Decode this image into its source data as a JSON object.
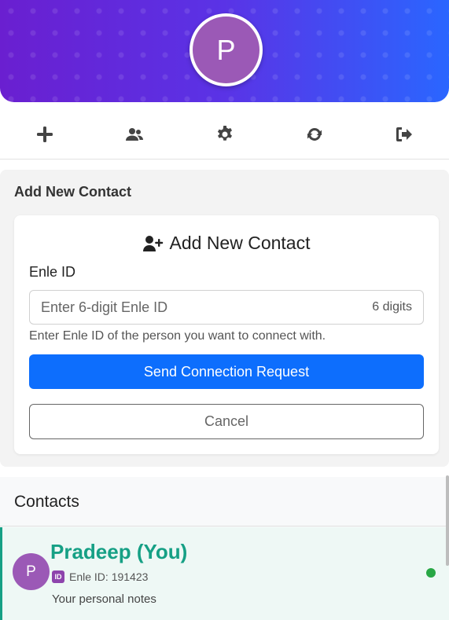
{
  "header": {
    "avatar_initial": "P"
  },
  "toolbar": {
    "items": [
      {
        "icon": "plus-icon"
      },
      {
        "icon": "users-icon"
      },
      {
        "icon": "gear-icon"
      },
      {
        "icon": "refresh-icon"
      },
      {
        "icon": "logout-icon"
      }
    ]
  },
  "add_contact": {
    "panel_title": "Add New Contact",
    "card_title": "Add New Contact",
    "field_label": "Enle ID",
    "input_placeholder": "Enter 6-digit Enle ID",
    "input_value": "",
    "input_hint": "6 digits",
    "help_text": "Enter Enle ID of the person you want to connect with.",
    "send_label": "Send Connection Request",
    "cancel_label": "Cancel"
  },
  "contacts": {
    "title": "Contacts",
    "items": [
      {
        "initial": "P",
        "name": "Pradeep (You)",
        "id_badge": "ID",
        "id_text": "Enle ID: 191423",
        "note": "Your personal notes",
        "status": "online"
      }
    ]
  },
  "colors": {
    "header_gradient_start": "#6a1fd0",
    "header_gradient_end": "#2a66ff",
    "avatar": "#9b59b6",
    "primary": "#0d6efd",
    "contact_name": "#16a085",
    "online": "#28a745"
  }
}
